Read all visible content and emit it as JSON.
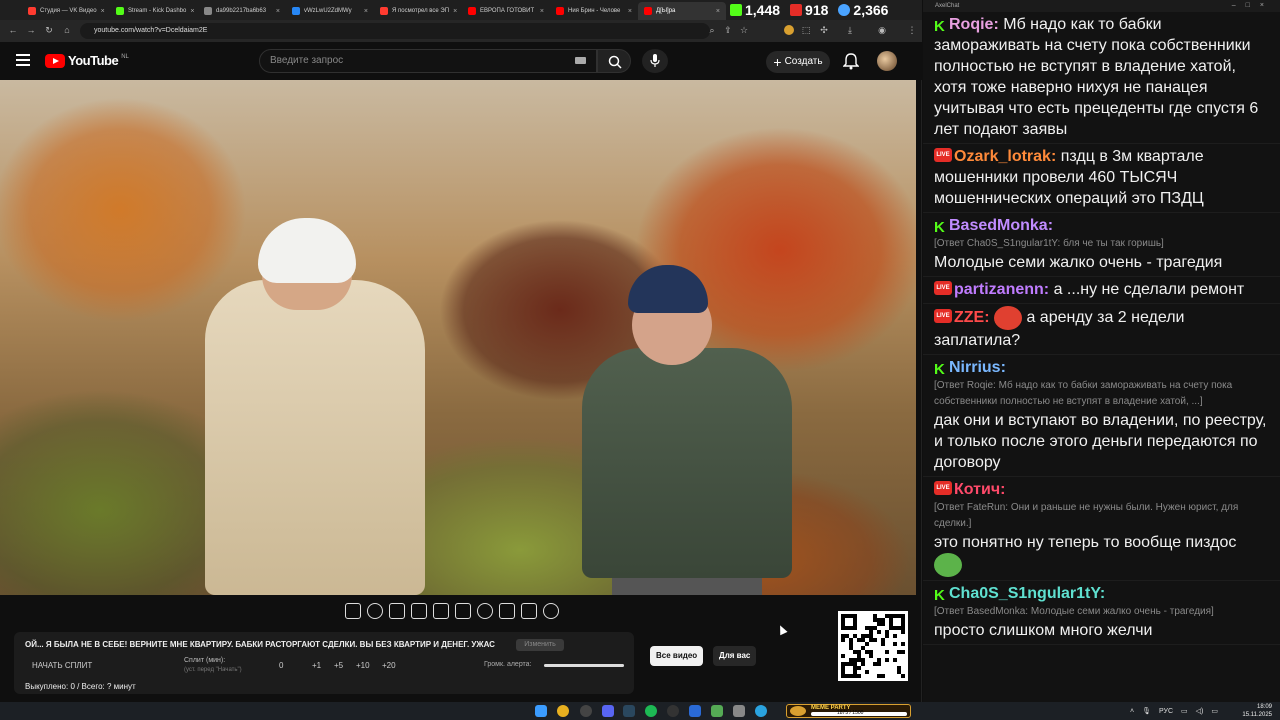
{
  "browser": {
    "tabs": [
      {
        "label": "Студия — VK Видео",
        "color": "#ff3b30"
      },
      {
        "label": "Stream - Kick Dashbo",
        "color": "#53fc18"
      },
      {
        "label": "da99b2217ba6b63",
        "color": "#888888"
      },
      {
        "label": "vWzLwU2ZdMWy",
        "color": "#2787f5"
      },
      {
        "label": "Я посмотрел все ЭП",
        "color": "#ff3b30"
      },
      {
        "label": "ЕВРОПА ГОТОВИТ",
        "color": "#ff0000"
      },
      {
        "label": "Ния Брин - Челове",
        "color": "#ff0000"
      },
      {
        "label": "Д[Ы]ра",
        "color": "#ff0000"
      }
    ],
    "url": "youtube.com/watch?v=Dceldaiam2E",
    "stats": {
      "kick_viewers": "1,448",
      "live_viewers": "918",
      "total_viewers": "2,366"
    }
  },
  "youtube": {
    "logo_text": "YouTube",
    "country": "NL",
    "search_placeholder": "Введите запрос",
    "create_label": "Создать"
  },
  "alert_panel": {
    "title": "ОЙ... Я БЫЛА НЕ В СЕБЕ! ВЕРНИТЕ МНЕ КВАРТИРУ. БАБКИ РАСТОРГАЮТ СДЕЛКИ. ВЫ БЕЗ КВАРТИР И ДЕНЕГ. УЖАС",
    "change_label": "Изменить",
    "start_split": "НАЧАТЬ СПЛИТ",
    "split_label": "Сплит (мин):",
    "split_sub": "(уст. перед \"Начать\")",
    "split_value": "0",
    "split_steps": [
      "+1",
      "+5",
      "+10",
      "+20"
    ],
    "volume_label": "Громк. алерта:",
    "volume_level": 1.0,
    "sold": "Выкуплено: 0 / Всего: ? минут"
  },
  "video_tabs": {
    "all": "Все видео",
    "for_you": "Для вас"
  },
  "chat": {
    "window_title": "AxelChat",
    "messages": [
      {
        "badge": "k",
        "user": "Roqie",
        "color": "#e8a0e0",
        "text": "Мб надо как то бабки замораживать на счету пока собственники полностью не вступят в владение хатой, хотя тоже наверно нихуя не панацея учитывая что есть прецеденты где спустя 6 лет подают заявы",
        "reply": ""
      },
      {
        "badge": "live",
        "user": "Ozark_lotrak",
        "color": "#ff8a3a",
        "text": "пздц в 3м квартале мошенники провели 460 ТЫСЯЧ мошеннических операций это ПЗДЦ",
        "reply": ""
      },
      {
        "badge": "k",
        "user": "BasedMonka",
        "color": "#c08cff",
        "text": "Молодые семи жалко очень - трагедия",
        "reply": "[Ответ Cha0S_S1ngular1tY: бля че ты так горишь]"
      },
      {
        "badge": "live",
        "user": "partizanenn",
        "color": "#c07cff",
        "text": "а ...ну не сделали ремонт",
        "reply": ""
      },
      {
        "badge": "live",
        "user": "ZZE",
        "color": "#ff4a4a",
        "text": "а аренду за 2 недели заплатила?",
        "reply": "",
        "emote": "#e04030"
      },
      {
        "badge": "k",
        "user": "Nirrius",
        "color": "#7ab8ff",
        "text": "дак они и вступают во владении, по реестру, и только после этого деньги передаются по договору",
        "reply": "[Ответ Roqie: Мб надо как то бабки замораживать на счету пока собственники полностью не вступят в владение хатой, ...]"
      },
      {
        "badge": "live",
        "user": "Котич",
        "color": "#ff4a6a",
        "text": "это понятно ну теперь то вообще пиздос",
        "reply": "[Ответ FateRun: Они и раньше не нужны были. Нужен юрист, для сделки.]",
        "emote_after": "#5cb34a"
      },
      {
        "badge": "k",
        "user": "Cha0S_S1ngular1tY",
        "color": "#5fe0d0",
        "text": "просто слишком много желчи",
        "reply": "[Ответ BasedMonka: Молодые семи жалко очень - трагедия]"
      }
    ]
  },
  "taskbar": {
    "meme_label": "MEME PARTY",
    "meme_count": "1875 / 1500",
    "meme_progress": 1.0,
    "lang": "РУС",
    "time": "18:09",
    "date": "15.11.2025"
  }
}
